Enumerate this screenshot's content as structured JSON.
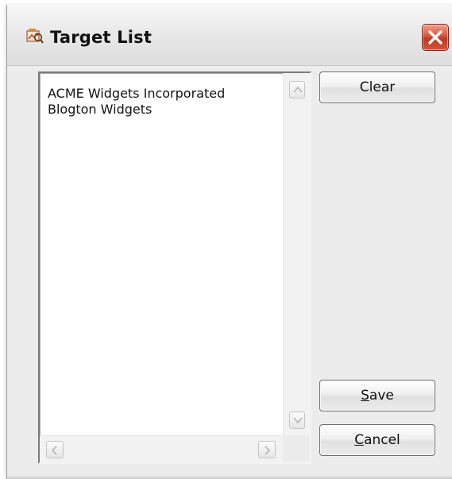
{
  "window": {
    "title": "Target List",
    "icon": "app-icon",
    "close_icon": "close-icon"
  },
  "list": {
    "items": [
      "ACME Widgets Incorporated",
      "Blogton Widgets"
    ]
  },
  "scrollbars": {
    "up_icon": "chevron-up-icon",
    "down_icon": "chevron-down-icon",
    "left_icon": "chevron-left-icon",
    "right_icon": "chevron-right-icon"
  },
  "buttons": {
    "clear": "Clear",
    "save": {
      "mnemonic": "S",
      "rest": "ave"
    },
    "cancel": {
      "mnemonic": "C",
      "rest": "ancel"
    }
  },
  "colors": {
    "close_button": "#c13a22",
    "dialog_background": "#ececec"
  }
}
